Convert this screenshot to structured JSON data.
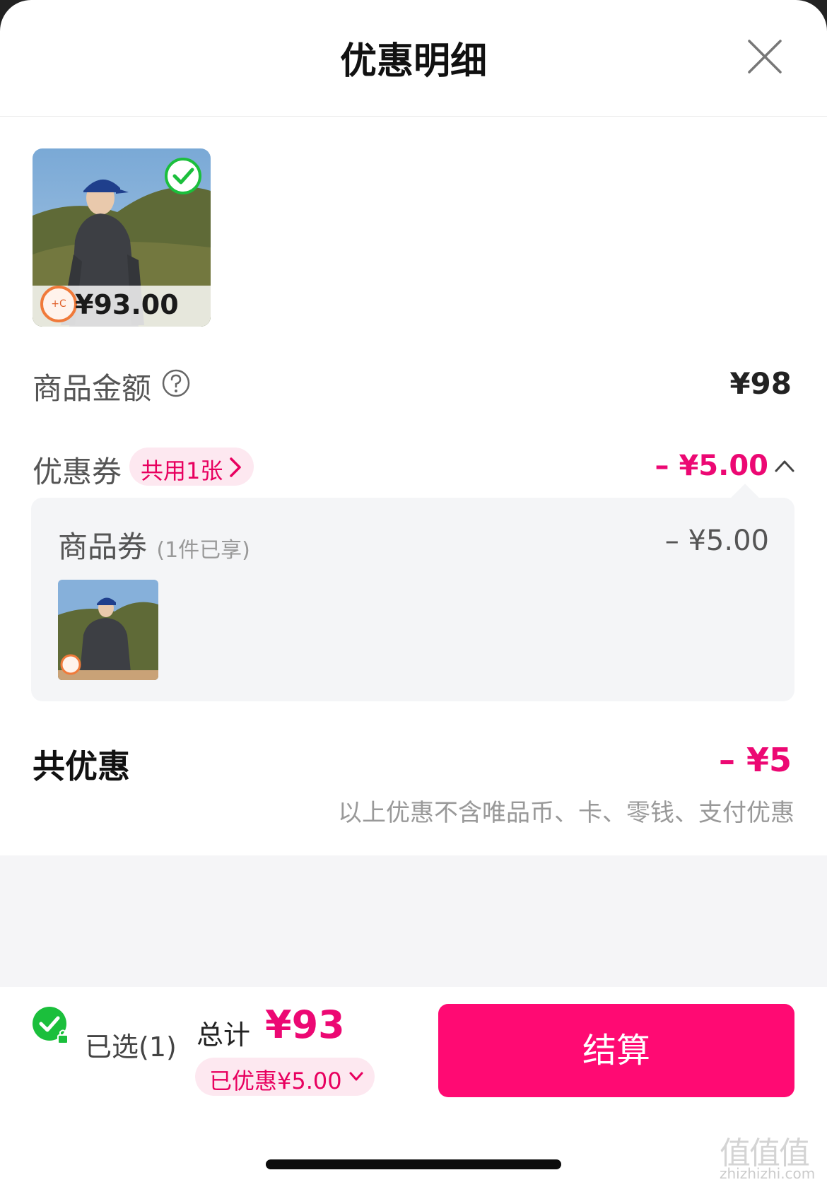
{
  "header": {
    "title": "优惠明细"
  },
  "product": {
    "price": "¥93.00",
    "badge_text": "+C",
    "image_alt": "hoodie-photo"
  },
  "goods_amount": {
    "label": "商品金额",
    "value": "¥98"
  },
  "coupon": {
    "label": "优惠券",
    "chip_label": "共用1张",
    "discount": "– ¥5.00"
  },
  "coupon_panel": {
    "label": "商品券",
    "sub_label": "(1件已享)",
    "amount": "– ¥5.00"
  },
  "total_discount": {
    "label": "共优惠",
    "value": "– ¥5",
    "note": "以上优惠不含唯品币、卡、零钱、支付优惠"
  },
  "bottom_bar": {
    "selected_label": "已选(1)",
    "total_label": "总计",
    "total_value": "¥93",
    "saved_label": "已优惠¥5.00",
    "checkout_label": "结算"
  },
  "watermark": {
    "text": "值值值",
    "url": "zhizhizhi.com"
  },
  "colors": {
    "accent": "#ff0a73",
    "accent_text": "#ec0873",
    "chip_bg": "#fde8f0",
    "check_green": "#1bbf3c"
  }
}
